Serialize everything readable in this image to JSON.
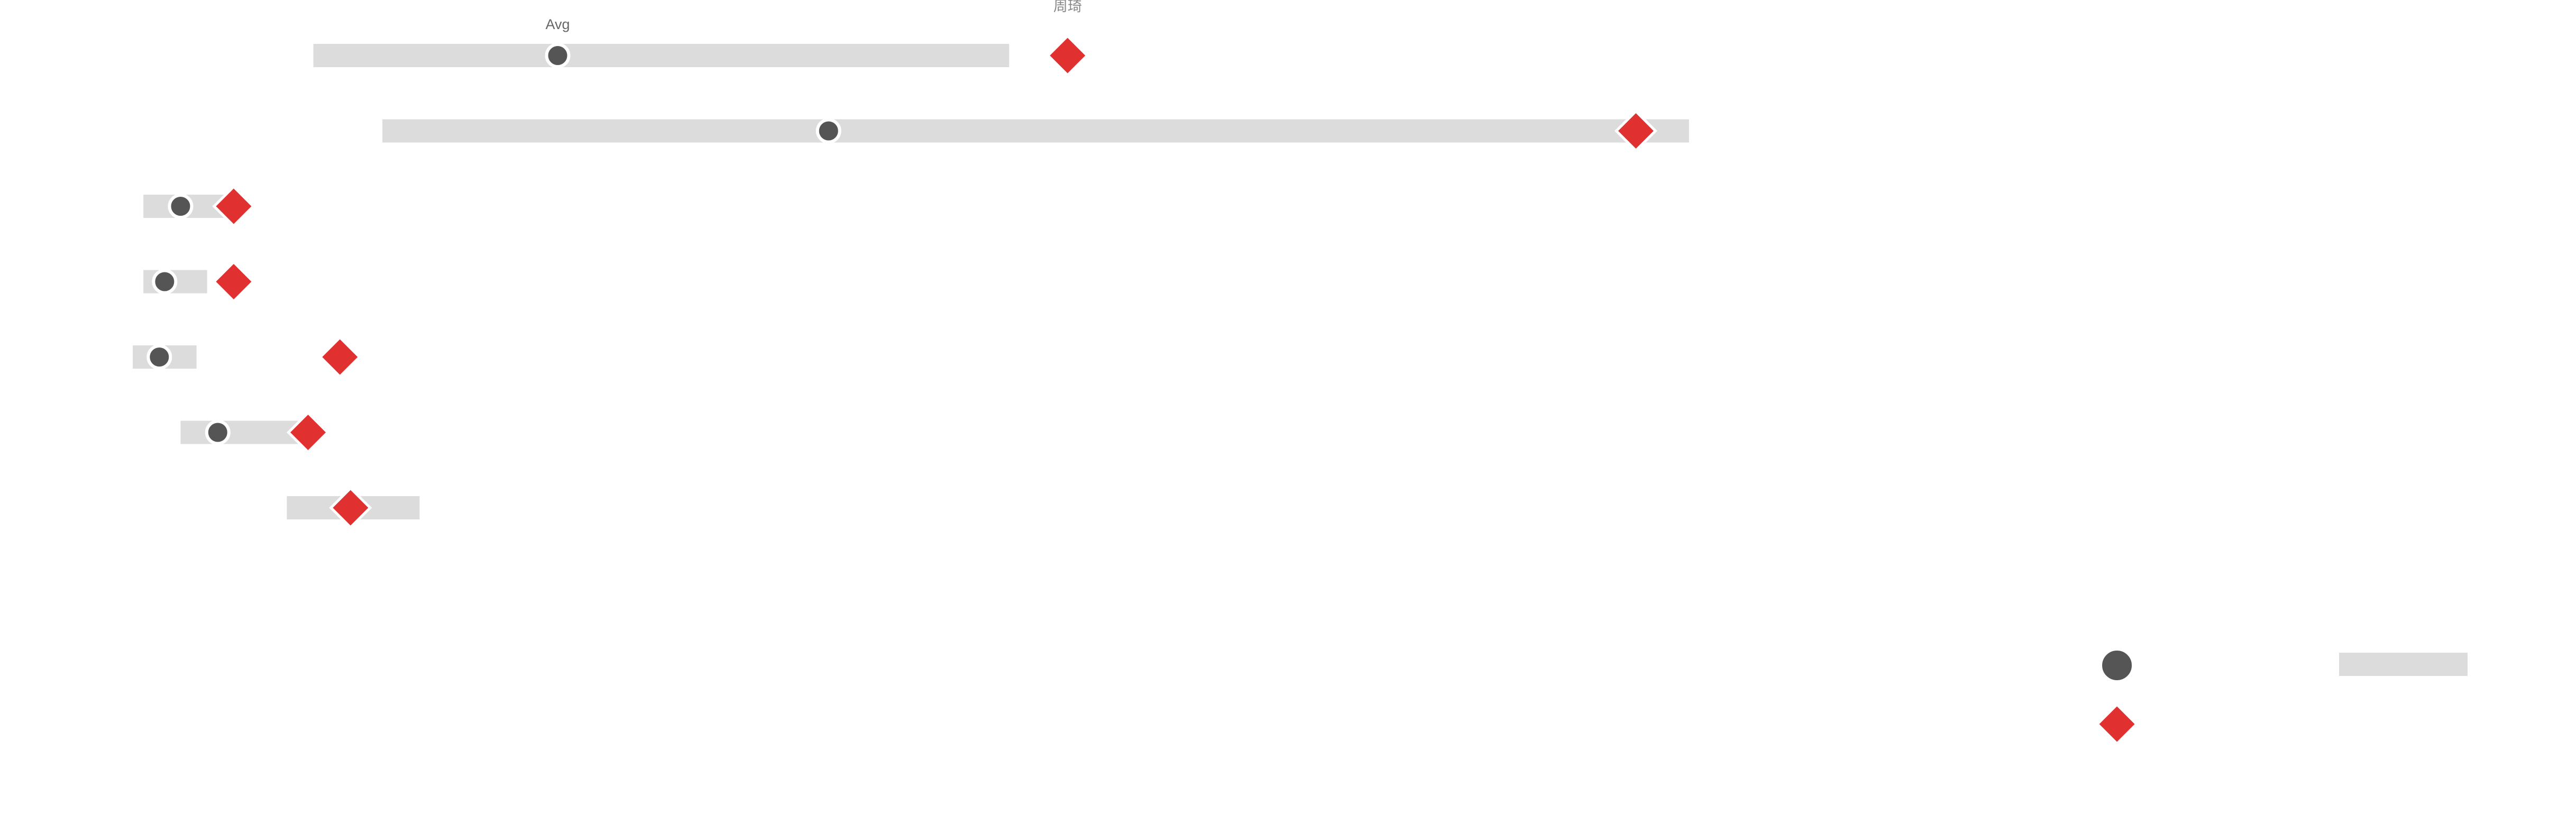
{
  "chart_data": {
    "type": "bullet-range",
    "title": "",
    "xlabel": "",
    "ylabel": "",
    "rows": [
      {
        "range": [
          5.9,
          19.0
        ],
        "avg": 10.5,
        "target": 20.1
      },
      {
        "range": [
          7.2,
          31.8
        ],
        "avg": 15.6,
        "target": 30.8
      },
      {
        "range": [
          2.7,
          4.3
        ],
        "avg": 3.4,
        "target": 4.4
      },
      {
        "range": [
          2.7,
          3.9
        ],
        "avg": 3.1,
        "target": 4.4
      },
      {
        "range": [
          2.5,
          3.7
        ],
        "avg": 3.0,
        "target": 6.4
      },
      {
        "range": [
          3.4,
          5.8
        ],
        "avg": 4.1,
        "target": 5.8
      },
      {
        "range": [
          5.4,
          7.9
        ],
        "avg": null,
        "target": 6.6
      }
    ],
    "annotations": {
      "avg_label": "Avg",
      "target_label": "周琦"
    },
    "legend": {
      "position": "bottom-right",
      "items": [
        {
          "symbol": "circle"
        },
        {
          "symbol": "diamond"
        }
      ]
    },
    "xlim": [
      0,
      48.5
    ],
    "grid": false,
    "colors": {
      "range": "#dcdcdc",
      "avg": "#555555",
      "target": "#e03030",
      "text": "#666666"
    }
  }
}
